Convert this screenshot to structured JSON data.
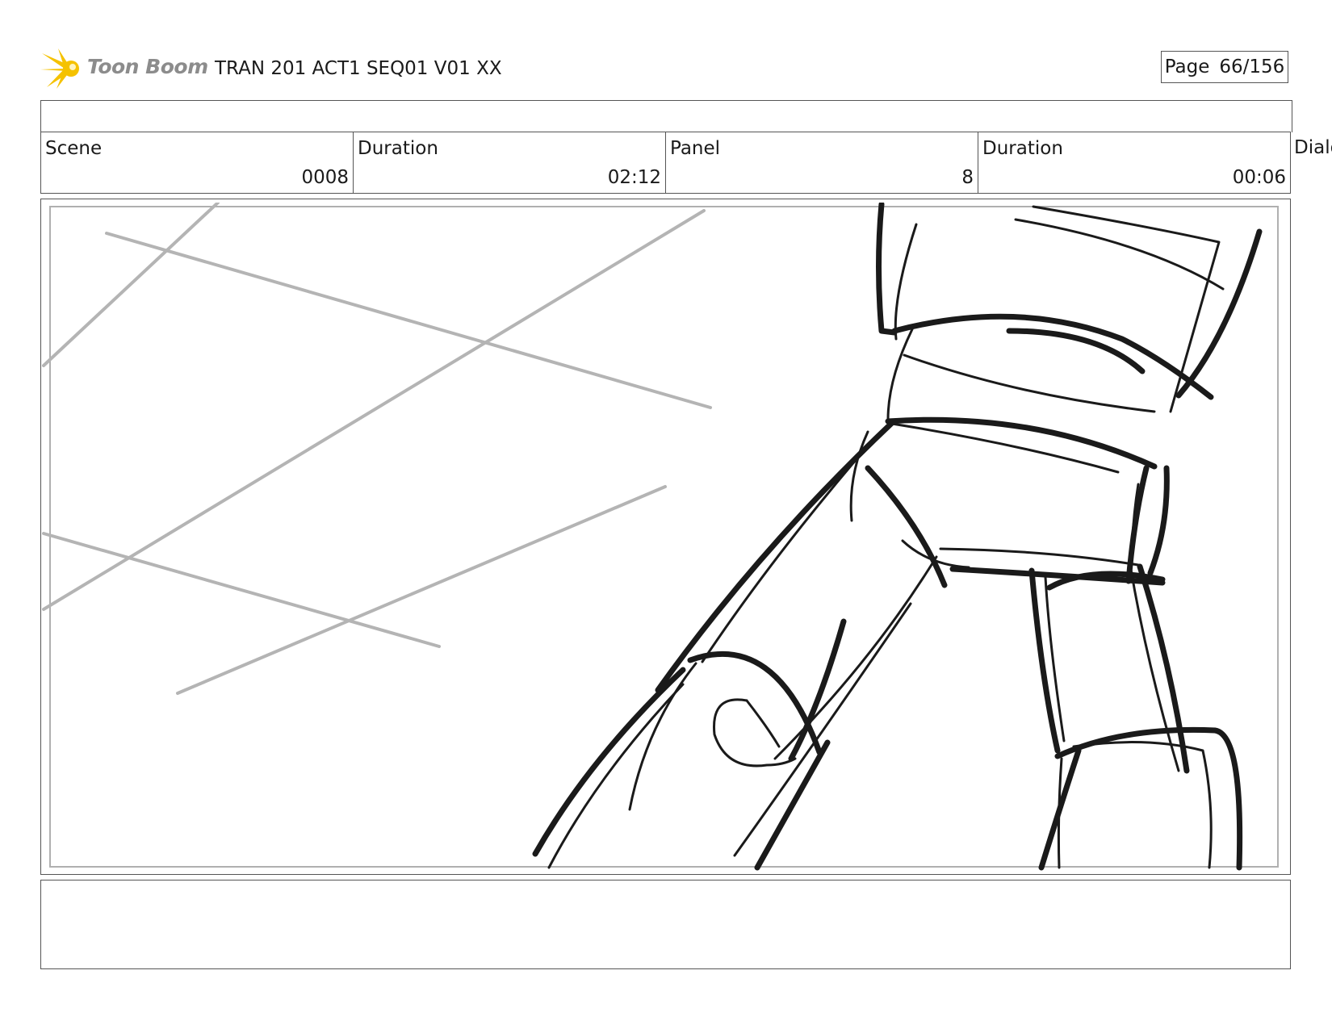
{
  "header": {
    "logo_text": "Toon Boom",
    "logo_color": "#f5c200",
    "title": "TRAN 201 ACT1 SEQ01 V01 XX",
    "page_label": "Page",
    "page_value": "66/156"
  },
  "info": {
    "scene_label": "Scene",
    "scene_value": "0008",
    "scene_duration_label": "Duration",
    "scene_duration_value": "02:12",
    "panel_label": "Panel",
    "panel_value": "8",
    "panel_duration_label": "Duration",
    "panel_duration_value": "00:06",
    "dialog_label": "Dialog"
  },
  "panel": {
    "image": "storyboard sketch of a robotic arm with perspective guide lines",
    "notes": ""
  }
}
